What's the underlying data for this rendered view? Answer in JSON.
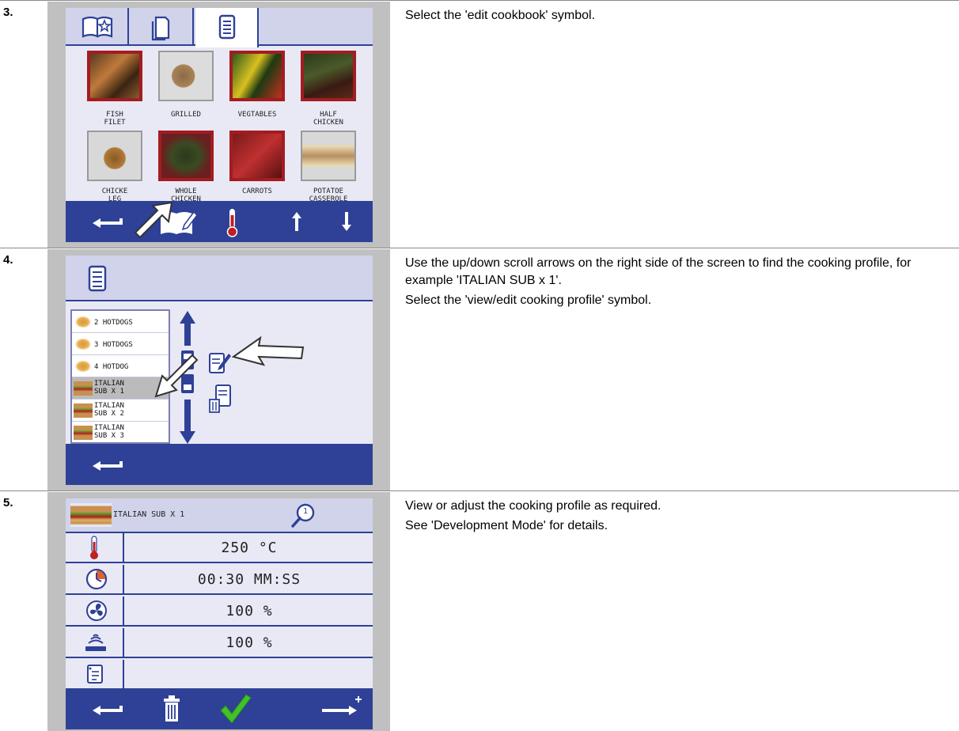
{
  "steps": [
    {
      "number": "3.",
      "instructions": [
        "Select the 'edit cookbook' symbol."
      ],
      "cookbook_tiles": [
        {
          "label_line1": "FISH",
          "label_line2": "FILET"
        },
        {
          "label_line1": "GRILLED",
          "label_line2": ""
        },
        {
          "label_line1": "VEGTABLES",
          "label_line2": ""
        },
        {
          "label_line1": "HALF",
          "label_line2": "CHICKEN"
        },
        {
          "label_line1": "CHICKE",
          "label_line2": "LEG"
        },
        {
          "label_line1": "WHOLE",
          "label_line2": "CHICKEN"
        },
        {
          "label_line1": "CARROTS",
          "label_line2": ""
        },
        {
          "label_line1": "POTATOE",
          "label_line2": "CASSEROLE"
        }
      ]
    },
    {
      "number": "4.",
      "instructions": [
        "Use the up/down scroll arrows on the right side of the screen to find the cooking profile, for example 'ITALIAN SUB x 1'.",
        "Select the 'view/edit cooking profile' symbol."
      ],
      "profile_list": [
        {
          "line1": "2 HOTDOGS",
          "line2": ""
        },
        {
          "line1": "3 HOTDOGS",
          "line2": ""
        },
        {
          "line1": "4 HOTDOG",
          "line2": ""
        },
        {
          "line1": "ITALIAN",
          "line2": "SUB X 1",
          "selected": true
        },
        {
          "line1": "ITALIAN",
          "line2": "SUB X 2"
        },
        {
          "line1": "ITALIAN",
          "line2": "SUB X 3"
        }
      ]
    },
    {
      "number": "5.",
      "instructions": [
        "View or adjust the cooking profile as required.",
        "See 'Development Mode' for details."
      ],
      "profile_title": "ITALIAN SUB X 1",
      "zoom_badge": "1",
      "settings": [
        {
          "icon": "thermometer-icon",
          "value": "250 °C"
        },
        {
          "icon": "clock-icon",
          "value": "00:30 MM:SS"
        },
        {
          "icon": "fan-icon",
          "value": "100 %"
        },
        {
          "icon": "microwave-icon",
          "value": "100 %"
        },
        {
          "icon": "info-icon",
          "value": ""
        }
      ]
    }
  ],
  "colors": {
    "bar": "#2e4196",
    "screen_bg": "#e9e9f6",
    "header_bg": "#d0d3ea",
    "frame": "#c0c0c0",
    "tile_border": "#a31c20"
  }
}
